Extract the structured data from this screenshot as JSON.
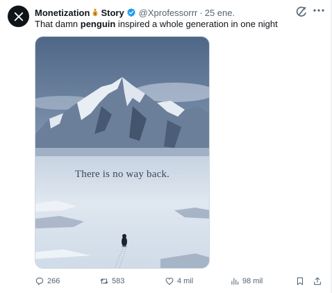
{
  "tweet": {
    "author_name_part1": "Monetization",
    "author_name_part2": "Story",
    "handle": "@Xprofessorrr",
    "separator": "·",
    "date": "25 ene.",
    "text_before": "That damn ",
    "text_bold": "penguin",
    "text_after": " inspired a whole generation in one night"
  },
  "media": {
    "caption": "There is no way back."
  },
  "actions": {
    "replies": "266",
    "reposts": "583",
    "likes": "4 mil",
    "views": "98 mil"
  },
  "colors": {
    "text": "#0f1419",
    "secondary": "#536471",
    "verified": "#1d9bf0",
    "avatar_bg": "#0f1419"
  },
  "icons": [
    "x-logo-icon",
    "money-bag-icon",
    "verified-badge-icon",
    "grok-icon",
    "more-icon",
    "reply-icon",
    "repost-icon",
    "like-icon",
    "views-icon",
    "bookmark-icon",
    "share-icon"
  ]
}
